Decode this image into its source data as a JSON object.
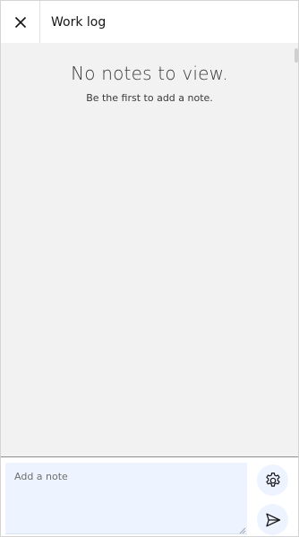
{
  "header": {
    "title": "Work log",
    "close_icon": "close-icon"
  },
  "empty_state": {
    "title": "No notes to view.",
    "subtitle": "Be the first to add a note."
  },
  "composer": {
    "placeholder": "Add a note",
    "value": "",
    "settings_icon": "gear-icon",
    "send_icon": "send-icon"
  },
  "colors": {
    "panel_background": "#f2f2f2",
    "header_background": "#ffffff",
    "input_background": "#edf4ff",
    "text_primary": "#161616",
    "text_secondary": "#393939"
  }
}
